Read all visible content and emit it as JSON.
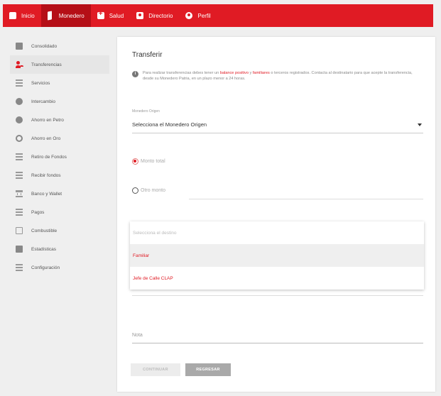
{
  "nav": {
    "items": [
      {
        "label": "Inicio",
        "icon": "chat-icon"
      },
      {
        "label": "Monedero",
        "icon": "wallet-icon"
      },
      {
        "label": "Salud",
        "icon": "medical-icon"
      },
      {
        "label": "Directorio",
        "icon": "directory-icon"
      },
      {
        "label": "Perfil",
        "icon": "user-icon"
      }
    ],
    "active": "Monedero"
  },
  "sidebar": {
    "items": [
      {
        "label": "Consolidado",
        "icon": "consolidated-icon"
      },
      {
        "label": "Transferencias",
        "icon": "transfer-icon"
      },
      {
        "label": "Servicios",
        "icon": "services-icon"
      },
      {
        "label": "Intercambio",
        "icon": "exchange-icon"
      },
      {
        "label": "Ahorro en Petro",
        "icon": "petro-savings-icon"
      },
      {
        "label": "Ahorro en Oro",
        "icon": "gold-savings-icon"
      },
      {
        "label": "Retiro de Fondos",
        "icon": "withdraw-icon"
      },
      {
        "label": "Recibir fondos",
        "icon": "receive-icon"
      },
      {
        "label": "Banco y Wallet",
        "icon": "bank-icon"
      },
      {
        "label": "Pagos",
        "icon": "payments-icon"
      },
      {
        "label": "Combustible",
        "icon": "fuel-icon"
      },
      {
        "label": "Estadísticas",
        "icon": "stats-icon"
      },
      {
        "label": "Configuración",
        "icon": "settings-icon"
      }
    ],
    "active": "Transferencias"
  },
  "main": {
    "title": "Transferir",
    "info": {
      "pre": "Para realizar transferencias debes tener un ",
      "hl1": "balance positivo",
      "mid": " y ",
      "hl2": "familiares",
      "post": " o terceros registrados. Contacta al destinatario para que acepte la transferencia, desde su Monedero Patria, en un plazo menor a 24 horas."
    },
    "origin": {
      "label": "Monedero Origen",
      "value": "Selecciona el Monedero Origen"
    },
    "amount": {
      "total_label": "Monto total",
      "other_label": "Otro monto",
      "selected": "total"
    },
    "destination": {
      "placeholder": "Selecciona el destino",
      "options": [
        "Familiar",
        "Jefe de Calle CLAP"
      ],
      "highlighted": "Familiar"
    },
    "note": {
      "placeholder": "Nota"
    },
    "buttons": {
      "continue": "CONTINUAR",
      "back": "REGRESAR"
    }
  },
  "colors": {
    "brand": "#e01b24",
    "brand_dark": "#b50f17"
  }
}
